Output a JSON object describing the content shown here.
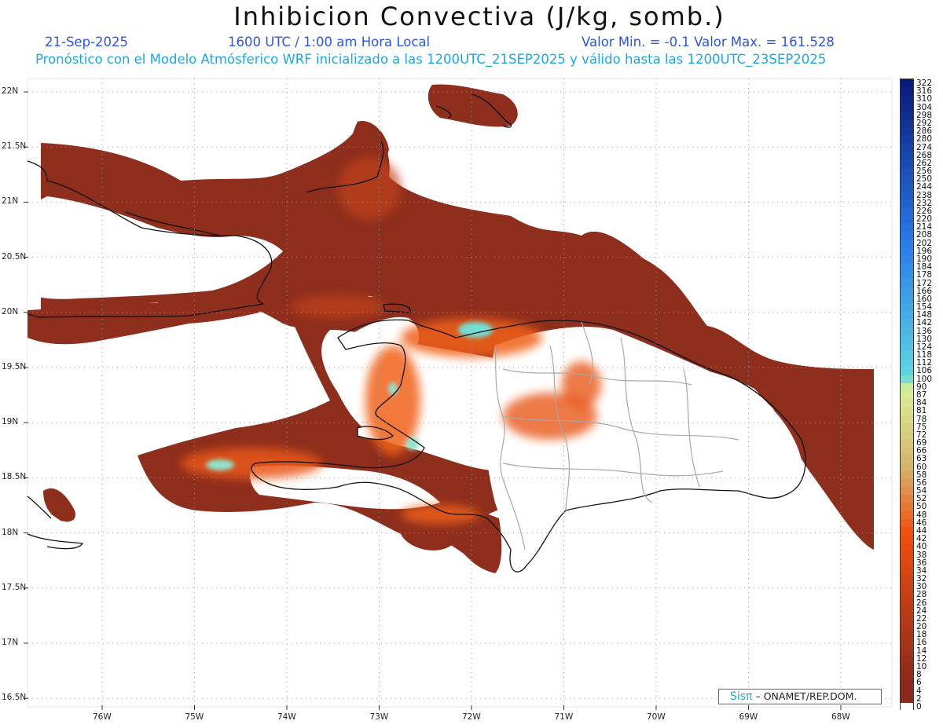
{
  "header": {
    "title": "Inhibicion Convectiva (J/kg, somb.)",
    "date": "21-Sep-2025",
    "time": "1600 UTC / 1:00 am Hora Local",
    "stats": "Valor Min. = -0.1  Valor Max. = 161.528",
    "subtitle": "Pronóstico con el Modelo Atmósferico WRF inicializado a las 1200UTC_21SEP2025 y válido hasta las  1200UTC_23SEP2025"
  },
  "axes": {
    "lat_labels": [
      "22N",
      "21.5N",
      "21N",
      "20.5N",
      "20N",
      "19.5N",
      "19N",
      "18.5N",
      "18N",
      "17.5N",
      "17N",
      "16.5N"
    ],
    "lon_labels": [
      "76W",
      "75W",
      "74W",
      "73W",
      "72W",
      "71W",
      "70W",
      "69W",
      "68W"
    ]
  },
  "colorbar": {
    "labels": [
      "322",
      "316",
      "310",
      "304",
      "298",
      "292",
      "286",
      "280",
      "274",
      "268",
      "262",
      "256",
      "250",
      "244",
      "238",
      "232",
      "226",
      "220",
      "214",
      "208",
      "202",
      "196",
      "190",
      "184",
      "178",
      "172",
      "166",
      "160",
      "154",
      "148",
      "142",
      "136",
      "130",
      "124",
      "118",
      "112",
      "106",
      "100",
      "90",
      "87",
      "84",
      "81",
      "78",
      "75",
      "72",
      "69",
      "66",
      "63",
      "60",
      "58",
      "56",
      "54",
      "52",
      "50",
      "48",
      "46",
      "44",
      "42",
      "40",
      "38",
      "36",
      "34",
      "32",
      "30",
      "28",
      "26",
      "24",
      "22",
      "20",
      "18",
      "16",
      "14",
      "12",
      "10",
      "8",
      "6",
      "4",
      "2",
      "0"
    ],
    "colors": {
      "top": "#0a1a78",
      "blue": "#2a7de8",
      "cyan": "#5fd6e0",
      "pale": "#d9ef9a",
      "tan": "#d6b06a",
      "orange": "#f05010",
      "brown": "#8a2a1c",
      "zero": "#ffffff"
    }
  },
  "credit": {
    "brand": "Sisπ",
    "text": "– ONAMET/REP.DOM."
  }
}
